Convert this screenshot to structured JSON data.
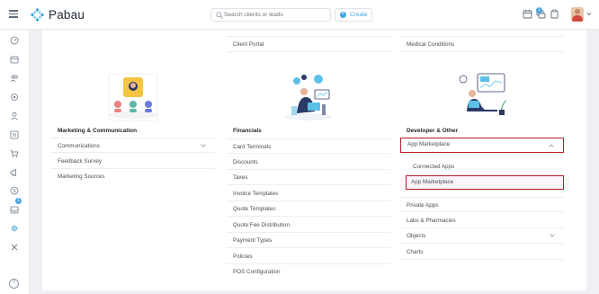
{
  "app": {
    "name": "Pabau"
  },
  "search": {
    "placeholder": "Search clients or leads"
  },
  "create": {
    "label": "Create"
  },
  "notifications": {
    "count": "1"
  },
  "sidebar": {
    "badge_count": "1",
    "help": "?"
  },
  "col1": {
    "heading": "Marketing & Communication",
    "rows": [
      "Communications",
      "Feedback Survey",
      "Marketing Sources"
    ]
  },
  "col2": {
    "top_rows": [
      "Client Portal"
    ],
    "heading": "Financials",
    "rows": [
      "Card Terminals",
      "Discounts",
      "Taxes",
      "Invoice Templates",
      "Quote Templates",
      "Quote Fee Distribution",
      "Payment Types",
      "Policies",
      "POS Configuration"
    ]
  },
  "col3": {
    "top_rows": [
      "Medical Conditions"
    ],
    "heading": "Developer & Other",
    "expanded": "App Marketplace",
    "sub_items": [
      "Connected Apps",
      "App Marketplace"
    ],
    "rows": [
      "Private Apps",
      "Labs & Pharmacies",
      "Objects",
      "Charts"
    ]
  },
  "colors": {
    "accent": "#3da6e0",
    "highlight": "#b81e24"
  }
}
